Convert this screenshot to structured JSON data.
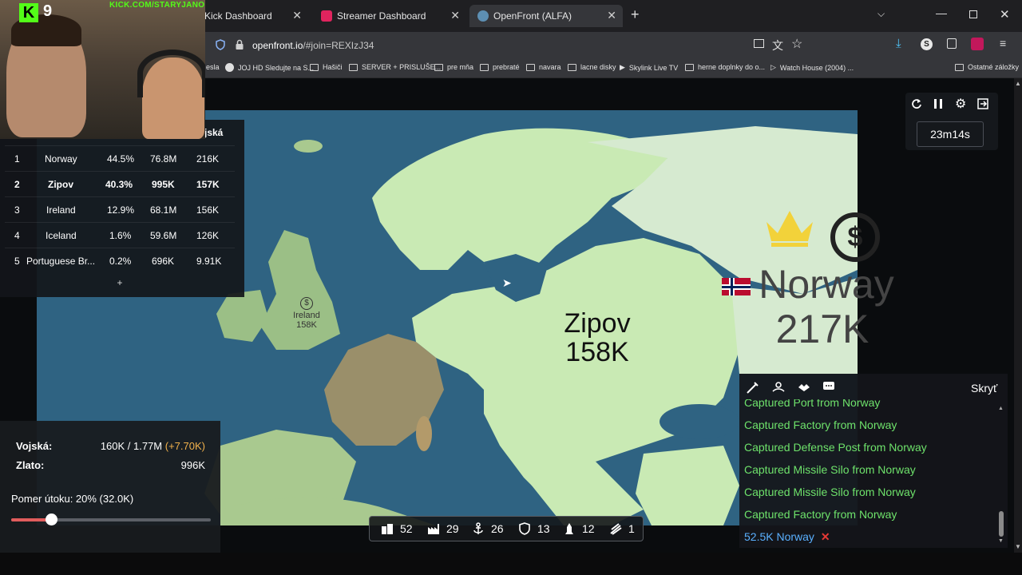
{
  "browser": {
    "tabs": [
      {
        "label": "Kick Dashboard"
      },
      {
        "label": "Streamer Dashboard"
      },
      {
        "label": "OpenFront (ALFA)"
      }
    ],
    "url_host": "openfront.io",
    "url_path": "/#join=REXIzJ34",
    "bookmarks": [
      "esla",
      "JOJ HD Sledujte na S...",
      "Hašiči",
      "SERVER + PRISLUŠE...",
      "pre mňa",
      "prebraté",
      "navara",
      "lacne disky",
      "Skylink Live TV",
      "herne doplnky do o...",
      "Watch House (2004) ...",
      "Ostatné záložky"
    ]
  },
  "stream": {
    "kick_logo": "K",
    "viewers": "9",
    "channel_url": "KICK.COM/STARYJANO"
  },
  "leaderboard": {
    "header": "jská",
    "rows": [
      {
        "rank": "1",
        "name": "Norway",
        "percent": "44.5%",
        "gold": "76.8M",
        "troops": "216K"
      },
      {
        "rank": "2",
        "name": "Zipov",
        "percent": "40.3%",
        "gold": "995K",
        "troops": "157K"
      },
      {
        "rank": "3",
        "name": "Ireland",
        "percent": "12.9%",
        "gold": "68.1M",
        "troops": "156K"
      },
      {
        "rank": "4",
        "name": "Iceland",
        "percent": "1.6%",
        "gold": "59.6M",
        "troops": "126K"
      },
      {
        "rank": "5",
        "name": "Portuguese Br...",
        "percent": "0.2%",
        "gold": "696K",
        "troops": "9.91K"
      }
    ],
    "add_label": "+"
  },
  "map": {
    "labels": [
      {
        "name": "Zipov",
        "troops": "158K"
      },
      {
        "name": "Norway",
        "troops": "217K"
      },
      {
        "name": "Ireland",
        "troops": "158K"
      }
    ]
  },
  "stats": {
    "troops_label": "Vojská:",
    "troops_value": "160K / 1.77M",
    "troops_delta": "(+7.70K)",
    "gold_label": "Zlato:",
    "gold_value": "996K",
    "attack_ratio_label": "Pomer útoku: 20% (32.0K)",
    "attack_ratio": 0.2
  },
  "controls": {
    "timer": "23m14s",
    "icons": [
      "restart-icon",
      "pause-icon",
      "settings-icon",
      "exit-icon"
    ]
  },
  "messages": {
    "hide_label": "Skryť",
    "items": [
      "Captured Port from Norway",
      "Captured Factory from Norway",
      "Captured Defense Post from Norway",
      "Captured Missile Silo from Norway",
      "Captured Missile Silo from Norway",
      "Captured Factory from Norway"
    ],
    "last": "52.5K Norway"
  },
  "buildings": [
    {
      "icon": "city-icon",
      "count": "52"
    },
    {
      "icon": "factory-icon",
      "count": "29"
    },
    {
      "icon": "port-icon",
      "count": "26"
    },
    {
      "icon": "defense-post-icon",
      "count": "13"
    },
    {
      "icon": "missile-silo-icon",
      "count": "12"
    },
    {
      "icon": "sam-launcher-icon",
      "count": "1"
    }
  ],
  "colors": {
    "player_territory": "#c9eab4",
    "norway_territory": "#d6ead0",
    "ireland_territory": "#9bbf86",
    "neutral_land": "#a9c98f",
    "sea": "#2f6382",
    "message_green": "#6ee26b",
    "message_blue": "#5ab0ff",
    "kick_green": "#53fc18",
    "delta_orange": "#f2b24c"
  }
}
